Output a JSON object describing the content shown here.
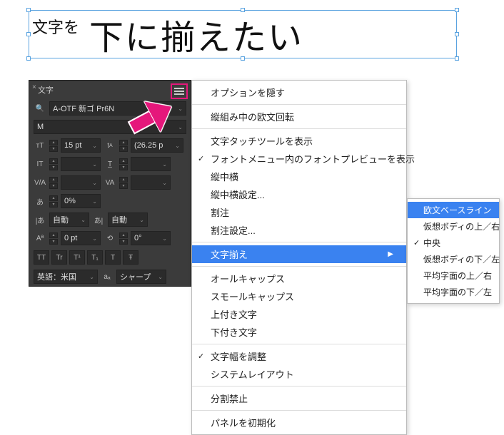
{
  "textFrame": {
    "smallText": "文字を",
    "bigText": "下に揃えたい"
  },
  "panel": {
    "tabName": "文字",
    "font": "A-OTF 新ゴ Pr6N",
    "fontStyle": "M",
    "size": "15 pt",
    "leading": "(26.25 p",
    "vscale": "",
    "hscale": "",
    "kerning": "",
    "tracking": "",
    "baseline": "0%",
    "tsume": "自動",
    "aki1": "自動",
    "shift": "0 pt",
    "rotate": "0°",
    "language": "英語：米国",
    "antialias": "シャープ",
    "btn": {
      "tt1": "TT",
      "tt2": "Tr",
      "t1": "T¹",
      "t1b": "T₁",
      "tu": "T",
      "ts": "Ŧ"
    }
  },
  "menu": {
    "hideOptions": "オプションを隠す",
    "tatechuyoko": "縦組み中の欧文回転",
    "touchTool": "文字タッチツールを表示",
    "fontPreview": "フォントメニュー内のフォントプレビューを表示",
    "tcy": "縦中横",
    "tcySettings": "縦中横設定...",
    "warichu": "割注",
    "warichuSettings": "割注設定...",
    "charAlign": "文字揃え",
    "allCaps": "オールキャップス",
    "smallCaps": "スモールキャップス",
    "superscript": "上付き文字",
    "subscript": "下付き文字",
    "adjustWidth": "文字幅を調整",
    "systemLayout": "システムレイアウト",
    "noBreak": "分割禁止",
    "resetPanel": "パネルを初期化"
  },
  "submenu": {
    "roman": "欧文ベースライン",
    "emTop": "仮想ボディの上／右",
    "center": "中央",
    "emBottom": "仮想ボディの下／左",
    "icfTop": "平均字面の上／右",
    "icfBottom": "平均字面の下／左"
  }
}
